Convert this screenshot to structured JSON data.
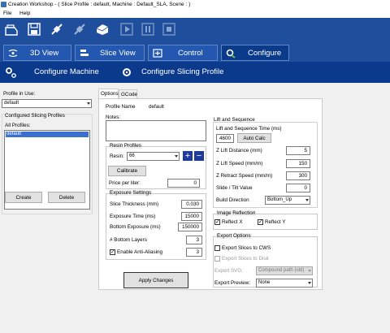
{
  "window": {
    "title": "Creation Workshop -  ( Slice Profile : default, Machine : Default_SLA, Scene : )"
  },
  "menu": {
    "file": "File",
    "help": "Help"
  },
  "main_tabs": [
    {
      "label": "3D View"
    },
    {
      "label": "Slice View"
    },
    {
      "label": "Control"
    },
    {
      "label": "Configure"
    }
  ],
  "sub_tabs": {
    "machine": "Configure Machine",
    "slicing": "Configure Slicing Profile"
  },
  "left": {
    "profile_in_use_label": "Profile in Use:",
    "profile_in_use_value": "default",
    "configured_label": "Configured Slicing Profiles",
    "all_profiles_label": "All Profiles:",
    "profiles": [
      "default"
    ],
    "create": "Create",
    "delete": "Delete"
  },
  "tabs": {
    "options": "Options",
    "gcode": "GCode"
  },
  "profile": {
    "name_label": "Profile Name",
    "name_value": "default",
    "notes_label": "Notes:"
  },
  "resin": {
    "title": "Resin Profiles",
    "resin_label": "Resin:",
    "resin_value": "66",
    "plus": "+",
    "minus": "−",
    "calibrate": "Calibrate",
    "price_label": "Price per liter:",
    "price_value": "0"
  },
  "exposure": {
    "title": "Exposure Settings",
    "thickness_label": "Slice Thickness (mm)",
    "thickness_value": "0.030",
    "time_label": "Exposure Time (ms)",
    "time_value": "15000",
    "bottom_label": "Bottom Exposure (ms)",
    "bottom_value": "150000",
    "layers_label": "# Bottom Layers",
    "layers_value": "3",
    "aa_label": "Enable Anti-Aliasing",
    "aa_value": "3"
  },
  "apply": "Apply Changes",
  "lift": {
    "title": "Lift and Sequence",
    "seq_label": "Lift and Sequence Time (ms)",
    "seq_value": "4600",
    "autocalc": "Auto Calc",
    "dist_label": "Z Lift Distance (mm)",
    "dist_value": "5",
    "speed_label": "Z Lift Speed (mm/m)",
    "speed_value": "150",
    "retract_label": "Z Retract Speed (mm/m)",
    "retract_value": "300",
    "tilt_label": "Slide / Tilt Value",
    "tilt_value": "0",
    "dir_label": "Build Direction",
    "dir_value": "Bottom_Up"
  },
  "reflection": {
    "title": "Image Reflection",
    "x": "Reflect X",
    "y": "Reflect Y"
  },
  "export": {
    "title": "Export Options",
    "cws": "Export Slices to CWS",
    "disk": "Export Slices to Disk",
    "svg_label": "Export SVG:",
    "svg_value": "Compound path (old)",
    "preview_label": "Export Preview:",
    "preview_value": "None"
  }
}
